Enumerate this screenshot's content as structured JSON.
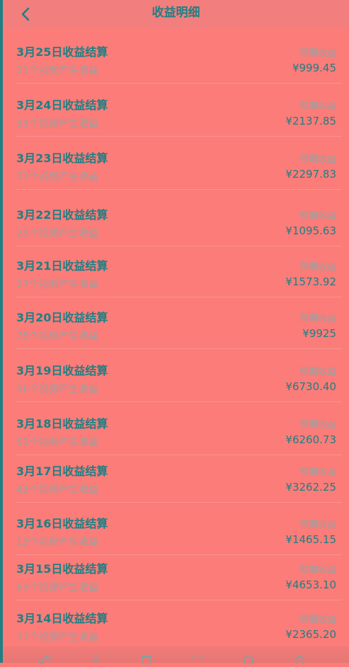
{
  "colors": {
    "background": "#fb7c78",
    "accent": "#1f7f84",
    "muted_text": "#9aa0a0"
  },
  "header": {
    "title": "收益明细",
    "back_icon": "chevron-left-icon"
  },
  "items": [
    {
      "title": "3月25日收益结算",
      "subtitle": "21个视频产生收益",
      "label": "预期收益",
      "amount": "¥999.45"
    },
    {
      "title": "3月24日收益结算",
      "subtitle": "33个视频产生收益",
      "label": "预期收益",
      "amount": "¥2137.85"
    },
    {
      "title": "3月23日收益结算",
      "subtitle": "33个视频产生收益",
      "label": "预期收益",
      "amount": "¥2297.83"
    },
    {
      "title": "3月22日收益结算",
      "subtitle": "25个视频产生收益",
      "label": "预期收益",
      "amount": "¥1095.63"
    },
    {
      "title": "3月21日收益结算",
      "subtitle": "27个视频产生收益",
      "label": "预期收益",
      "amount": "¥1573.92"
    },
    {
      "title": "3月20日收益结算",
      "subtitle": "75个视频产生收益",
      "label": "预期收益",
      "amount": "¥9925"
    },
    {
      "title": "3月19日收益结算",
      "subtitle": "56个视频产生收益",
      "label": "预期收益",
      "amount": "¥6730.40"
    },
    {
      "title": "3月18日收益结算",
      "subtitle": "51个视频产生收益",
      "label": "预期收益",
      "amount": "¥6260.73"
    },
    {
      "title": "3月17日收益结算",
      "subtitle": "43个视频产生收益",
      "label": "预期收益",
      "amount": "¥3262.25"
    },
    {
      "title": "3月16日收益结算",
      "subtitle": "13个视频产生收益",
      "label": "预期收益",
      "amount": "¥1465.15"
    },
    {
      "title": "3月15日收益结算",
      "subtitle": "63个视频产生收益",
      "label": "预期收益",
      "amount": "¥4653.10"
    },
    {
      "title": "3月14日收益结算",
      "subtitle": "33个视频产生收益",
      "label": "预期收益",
      "amount": "¥2365.20"
    }
  ],
  "toolbar": {
    "icons": [
      "share-icon",
      "download-icon",
      "delete-icon",
      "scan-icon",
      "crop-icon",
      "info-icon"
    ]
  }
}
